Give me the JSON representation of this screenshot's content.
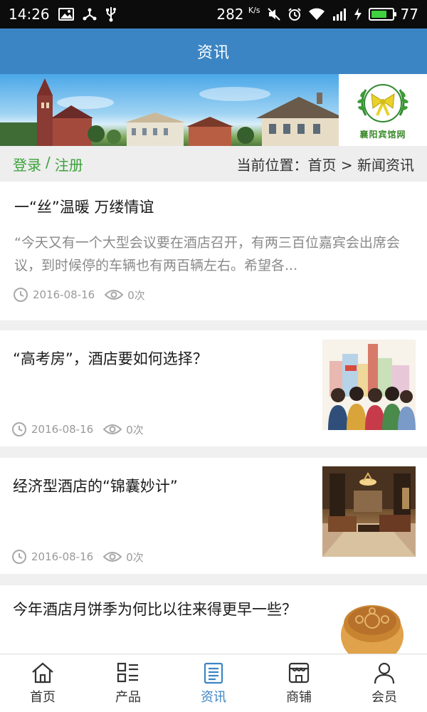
{
  "status_bar": {
    "time": "14:26",
    "speed": "282",
    "speed_unit": "K/s",
    "battery": "77",
    "battery_level": 0.77
  },
  "header": {
    "title": "资讯"
  },
  "banner": {
    "logo_text": "襄阳宾馆网"
  },
  "location_bar": {
    "login": "登录",
    "separator": "/",
    "register": "注册",
    "path": "当前位置：首页 > 新闻资讯"
  },
  "news": [
    {
      "title": "一“丝”温暖 万缕情谊",
      "summary": "“今天又有一个大型会议要在酒店召开，有两三百位嘉宾会出席会议，到时候停的车辆也有两百辆左右。希望各...",
      "date": "2016-08-16",
      "views": "0次"
    },
    {
      "title": "“高考房”，酒店要如何选择？",
      "date": "2016-08-16",
      "views": "0次"
    },
    {
      "title": "经济型酒店的“锦囊妙计”",
      "date": "2016-08-16",
      "views": "0次"
    },
    {
      "title": "今年酒店月饼季为何比以往来得更早一些？"
    }
  ],
  "tabs": [
    {
      "label": "首页",
      "icon": "home-icon"
    },
    {
      "label": "产品",
      "icon": "grid-list-icon"
    },
    {
      "label": "资讯",
      "icon": "news-icon",
      "active": true
    },
    {
      "label": "商铺",
      "icon": "shop-icon"
    },
    {
      "label": "会员",
      "icon": "user-icon"
    }
  ],
  "colors": {
    "header": "#3c85c4",
    "accent_green": "#3aa13a",
    "active_tab": "#3c85c4",
    "battery_green": "#3fd13f"
  }
}
